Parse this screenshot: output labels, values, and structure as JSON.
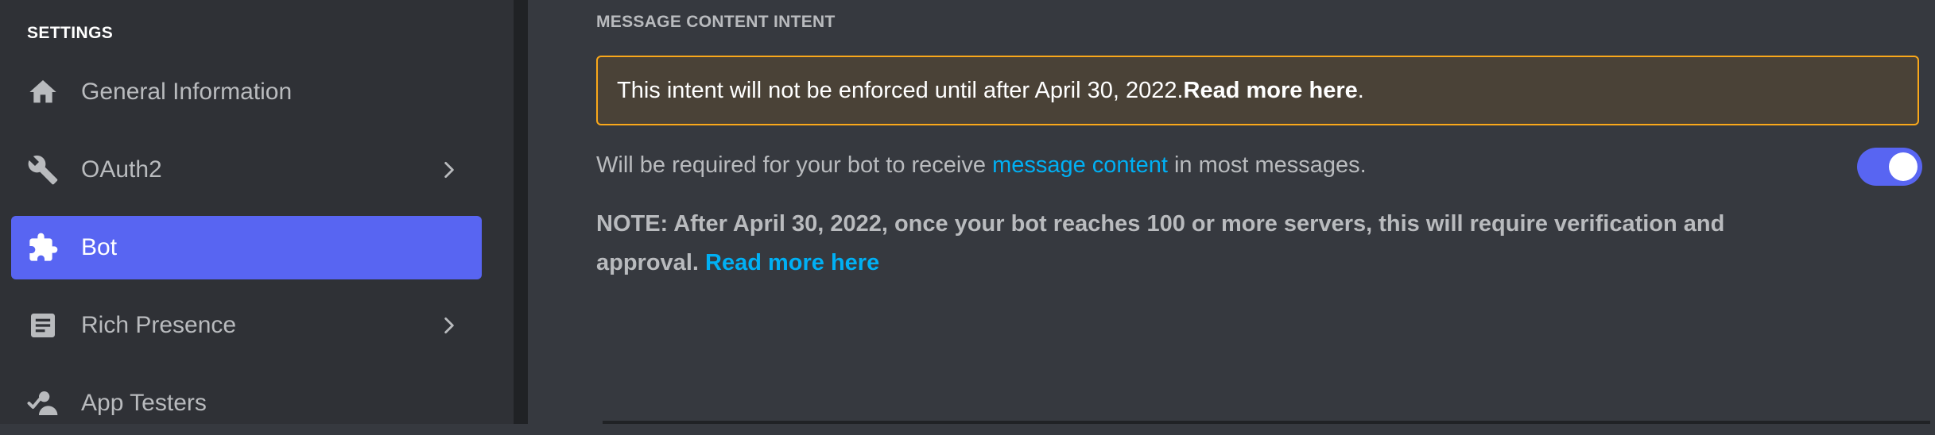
{
  "sidebar": {
    "section_title": "SETTINGS",
    "items": [
      {
        "label": "General Information",
        "icon": "home-icon",
        "has_chevron": false,
        "active": false
      },
      {
        "label": "OAuth2",
        "icon": "wrench-icon",
        "has_chevron": true,
        "active": false
      },
      {
        "label": "Bot",
        "icon": "puzzle-icon",
        "has_chevron": false,
        "active": true
      },
      {
        "label": "Rich Presence",
        "icon": "document-icon",
        "has_chevron": true,
        "active": false
      },
      {
        "label": "App Testers",
        "icon": "person-check-icon",
        "has_chevron": false,
        "active": false
      }
    ]
  },
  "intent": {
    "header": "MESSAGE CONTENT INTENT",
    "warning_text": "This intent will not be enforced until after April 30, 2022. ",
    "warning_link": "Read more here",
    "warning_end": ".",
    "desc_before": "Will be required for your bot to receive ",
    "desc_link": "message content",
    "desc_after": " in most messages.",
    "toggle_on": true,
    "note_text": "NOTE: After April 30, 2022, once your bot reaches 100 or more servers, this will require verification and approval. ",
    "note_link": "Read more here"
  },
  "colors": {
    "accent": "#5865f2",
    "link": "#00b0f4",
    "warning_border": "#faa81a",
    "sidebar_bg": "#2f3136",
    "content_bg": "#36393f"
  }
}
